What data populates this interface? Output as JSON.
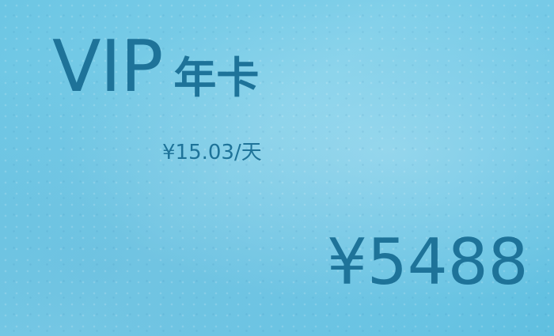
{
  "card": {
    "title": "VIP",
    "kind": "年卡",
    "per_day": "¥15.03/天",
    "price": "¥5488"
  },
  "colors": {
    "background": "#76cbe7",
    "text": "#1e7399"
  }
}
